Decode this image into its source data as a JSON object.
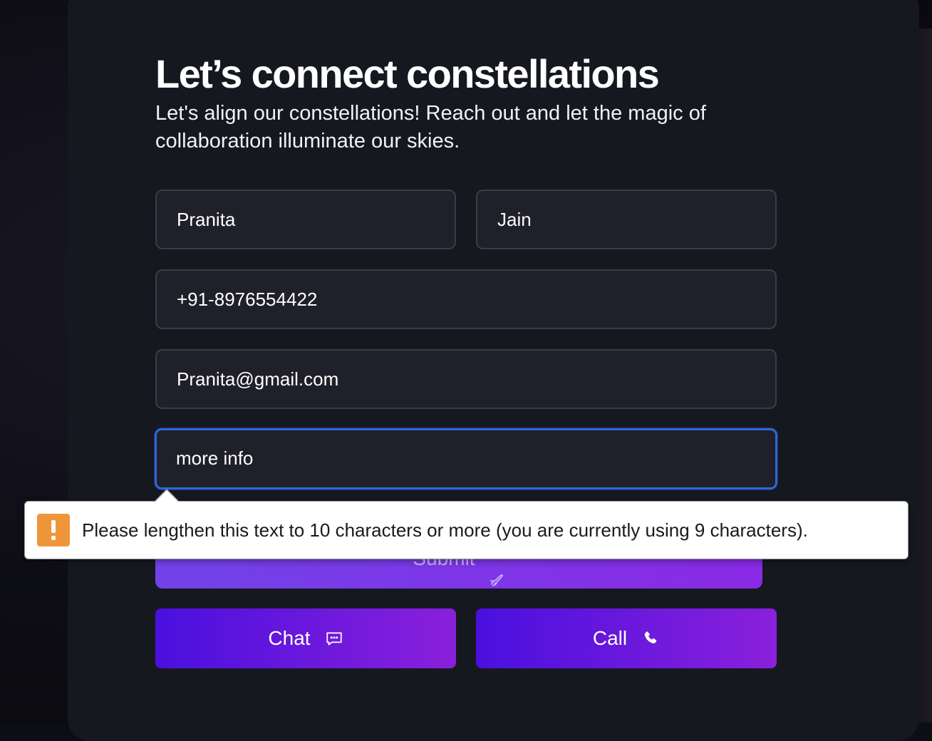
{
  "contact": {
    "heading": "Let’s connect constellations",
    "subtitle": "Let's align our constellations! Reach out and let the magic of collaboration illuminate our skies."
  },
  "form": {
    "first_name": "Pranita",
    "last_name": "Jain",
    "phone": "+91-8976554422",
    "email": "Pranita@gmail.com",
    "message": "more info",
    "submit_label": "Submit"
  },
  "actions": {
    "chat_label": "Chat",
    "call_label": "Call"
  },
  "validation": {
    "message": "Please lengthen this text to 10 characters or more (you are currently using 9 characters)."
  },
  "icons": {
    "submit": "rocket-icon",
    "chat": "chat-bubble-icon",
    "call": "phone-icon",
    "warning": "warning-icon"
  },
  "colors": {
    "card_bg": "#161820",
    "field_bg": "#1f2029",
    "focus_border": "#2d66d9",
    "button_gradient_start": "#4a10de",
    "button_gradient_end": "#8a20db",
    "warning": "#f0963a"
  }
}
